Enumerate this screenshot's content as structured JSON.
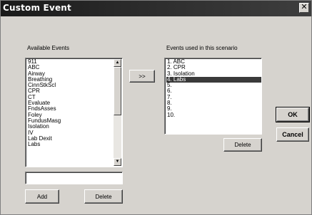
{
  "window": {
    "title": "Custom Event",
    "close_glyph": "✕"
  },
  "available": {
    "label": "Available Events",
    "items": [
      "911",
      "ABC",
      "Airway",
      "Breathing",
      "CinnStkScl",
      "CPR",
      "CT",
      "Evaluate",
      "FndsAsses",
      "Foley",
      "FundusMasg",
      "Isolation",
      "IV",
      "Lab Dexit",
      "Labs"
    ],
    "input_value": "",
    "add_label": "Add",
    "delete_label": "Delete"
  },
  "transfer_label": ">>",
  "scenario": {
    "label": "Events used in this scenario",
    "items": [
      "1. ABC",
      "2. CPR",
      "3. Isolation",
      "4. Labs",
      "5.",
      "6.",
      "7.",
      "8.",
      "9.",
      "10."
    ],
    "selected_index": 3,
    "delete_label": "Delete"
  },
  "dialog": {
    "ok_label": "OK",
    "cancel_label": "Cancel"
  },
  "icons": {
    "scroll_up": "up-arrow-icon",
    "scroll_down": "down-arrow-icon",
    "close": "close-icon"
  },
  "colors": {
    "titlebar": "#1a1a1a",
    "dialog_bg": "#d6d3ce",
    "selection": "#3a3a3a"
  }
}
